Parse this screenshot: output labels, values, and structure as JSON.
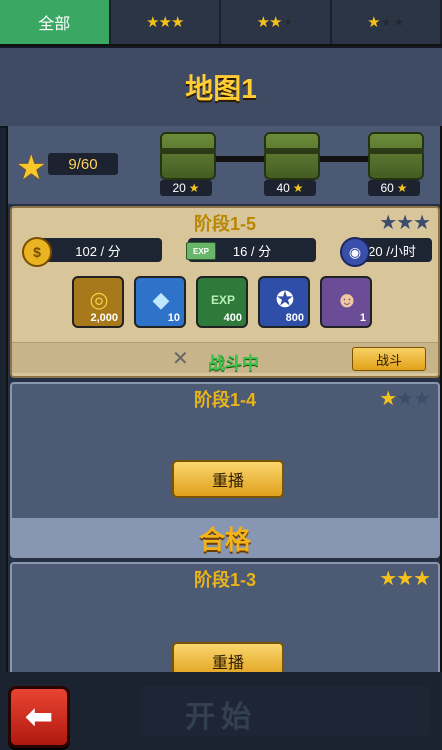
{
  "tabs": [
    {
      "label": "全部",
      "active": true
    },
    {
      "label": "★★★",
      "stars": 3
    },
    {
      "label": "★★★",
      "stars": 2
    },
    {
      "label": "★★★",
      "stars": 1
    }
  ],
  "map": {
    "title": "地图1"
  },
  "progress": {
    "stars": "9/60",
    "chests": [
      {
        "value": "20"
      },
      {
        "value": "40"
      },
      {
        "value": "60"
      }
    ]
  },
  "stage_active": {
    "title": "阶段1-5",
    "stars_earned": 0,
    "rates": [
      {
        "icon": "$",
        "text": "102 / 分"
      },
      {
        "icon": "EXP",
        "text": "16 / 分"
      },
      {
        "icon": "◉",
        "text": "20 /小时"
      }
    ],
    "rewards": [
      {
        "name": "gold-coins",
        "value": "2,000",
        "color": "#a8791a"
      },
      {
        "name": "diamond",
        "value": "10",
        "color": "#2f72c9"
      },
      {
        "name": "exp",
        "value": "400",
        "color": "#2d7a3a"
      },
      {
        "name": "medal",
        "value": "800",
        "color": "#2f4ea8"
      },
      {
        "name": "soldier",
        "value": "1",
        "color": "#6a4d96"
      }
    ],
    "status": "战斗中",
    "fight_button": "战斗"
  },
  "stage_2": {
    "title": "阶段1-4",
    "stars_earned": 1,
    "replay_button": "重播",
    "pass_text": "合格"
  },
  "stage_3": {
    "title": "阶段1-3",
    "stars_earned": 3,
    "replay_button": "重播"
  },
  "bottom": {
    "start_text": "开始",
    "back_icon": "back-arrow-icon"
  }
}
